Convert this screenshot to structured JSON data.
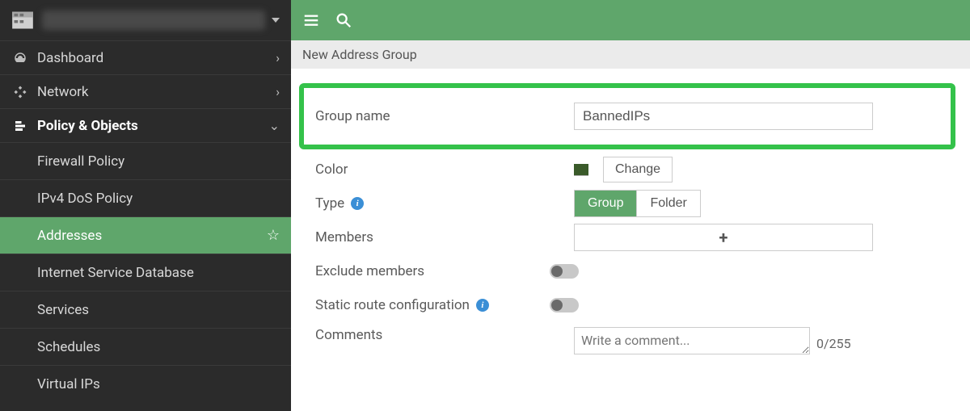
{
  "sidebar": {
    "items": [
      {
        "icon": "dashboard-icon",
        "label": "Dashboard",
        "chev": "›"
      },
      {
        "icon": "network-icon",
        "label": "Network",
        "chev": "›"
      },
      {
        "icon": "policy-icon",
        "label": "Policy & Objects",
        "chev": "⌄",
        "expanded": true
      }
    ],
    "subitems": [
      {
        "label": "Firewall Policy"
      },
      {
        "label": "IPv4 DoS Policy"
      },
      {
        "label": "Addresses",
        "active": true
      },
      {
        "label": "Internet Service Database"
      },
      {
        "label": "Services"
      },
      {
        "label": "Schedules"
      },
      {
        "label": "Virtual IPs"
      }
    ]
  },
  "breadcrumb": "New Address Group",
  "form": {
    "group_name_label": "Group name",
    "group_name_value": "BannedIPs",
    "color_label": "Color",
    "color_change": "Change",
    "type_label": "Type",
    "type_options": [
      "Group",
      "Folder"
    ],
    "type_selected": "Group",
    "members_label": "Members",
    "members_add": "+",
    "exclude_label": "Exclude members",
    "static_route_label": "Static route configuration",
    "comments_label": "Comments",
    "comments_placeholder": "Write a comment...",
    "comments_count": "0/255"
  }
}
